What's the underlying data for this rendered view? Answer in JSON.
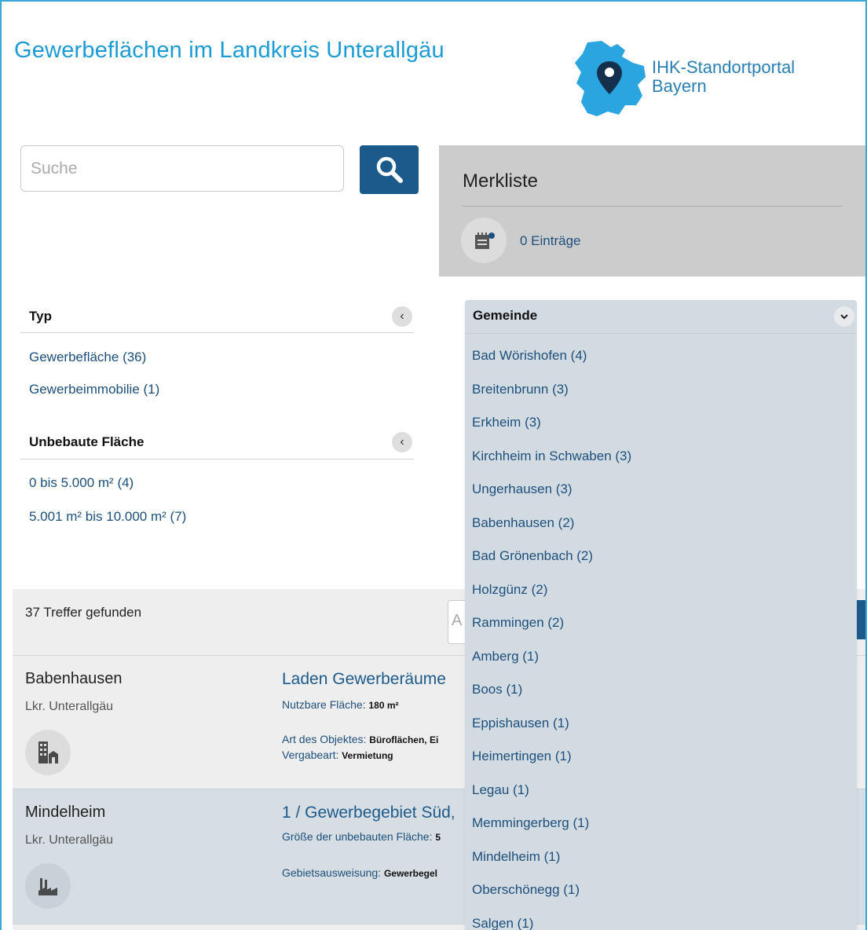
{
  "header": {
    "title": "Gewerbeflächen im Landkreis Unterallgäu",
    "logo": {
      "line1": "IHK-Standortportal",
      "line2": "Bayern",
      "brand_color": "#2a7fb3",
      "map_color": "#2aa5e0"
    }
  },
  "search": {
    "placeholder": "Suche",
    "value": "",
    "icon": "search-icon"
  },
  "merkliste": {
    "title": "Merkliste",
    "count_label": "0 Einträge",
    "icon": "notepad-icon"
  },
  "facets": {
    "typ": {
      "title": "Typ",
      "items": [
        "Gewerbefläche (36)",
        "Gewerbeimmobilie (1)"
      ]
    },
    "unbebaute": {
      "title": "Unbebaute Fläche",
      "items": [
        "0 bis 5.000 m² (4)",
        "5.001 m² bis 10.000 m² (7)"
      ]
    },
    "gemeinde": {
      "title": "Gemeinde",
      "items": [
        "Bad Wörishofen (4)",
        "Breitenbrunn (3)",
        "Erkheim (3)",
        "Kirchheim in Schwaben (3)",
        "Ungerhausen (3)",
        "Babenhausen (2)",
        "Bad Grönenbach (2)",
        "Holzgünz (2)",
        "Rammingen (2)",
        "Amberg (1)",
        "Boos (1)",
        "Eppishausen (1)",
        "Heimertingen (1)",
        "Legau (1)",
        "Memmingerberg (1)",
        "Mindelheim (1)",
        "Oberschönegg (1)",
        "Salgen (1)"
      ]
    }
  },
  "results": {
    "count_label": "37 Treffer gefunden",
    "sort_placeholder": "A",
    "items": [
      {
        "city": "Babenhausen",
        "region": "Lkr. Unterallgäu",
        "title": "Laden Gewerberäume",
        "meta1_label": "Nutzbare Fläche:",
        "meta1_value": "180 m²",
        "meta2_label": "Art des Objektes:",
        "meta2_value": "Büroflächen, Ei",
        "meta3_label": "Vergabeart:",
        "meta3_value": "Vermietung",
        "icon": "building-icon"
      },
      {
        "city": "Mindelheim",
        "region": "Lkr. Unterallgäu",
        "title": "1 / Gewerbegebiet Süd,",
        "meta1_label": "Größe der unbebauten Fläche:",
        "meta1_value": "5",
        "meta2_label": "Gebietsausweisung:",
        "meta2_value": "Gewerbegel",
        "icon": "factory-icon"
      }
    ]
  },
  "colors": {
    "accent": "#1a9bd6",
    "link": "#1d4f7c",
    "button": "#1d5a8c",
    "dropdown_bg": "#d3dbe2"
  }
}
